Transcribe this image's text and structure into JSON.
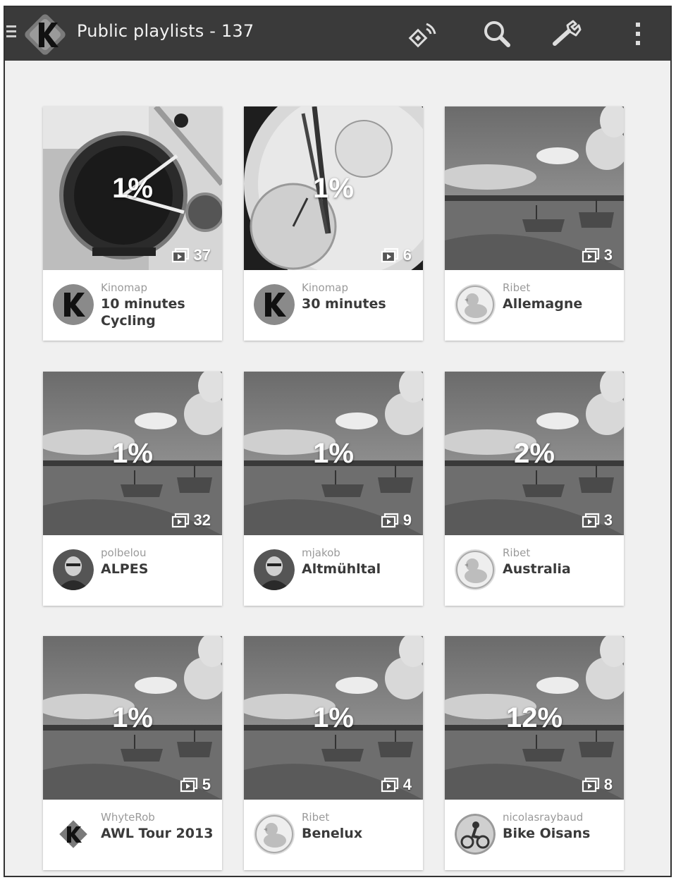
{
  "app": {
    "title": "Public playlists - 137",
    "colors": {
      "appbar": "#3a3a3a",
      "background": "#f0f0f0",
      "card": "#ffffff"
    }
  },
  "toolbar": {
    "icons": [
      "menu-icon",
      "kinomap-logo",
      "cast-icon",
      "search-icon",
      "wrench-icon",
      "overflow-menu-icon"
    ]
  },
  "playlists": [
    {
      "progress": "1%",
      "count": "37",
      "author": "Kinomap",
      "name": "10 minutes Cycling",
      "thumb": "speedometer",
      "avatar": "kinomap-avatar"
    },
    {
      "progress": "1%",
      "count": "6",
      "author": "Kinomap",
      "name": "30 minutes",
      "thumb": "watch",
      "avatar": "kinomap-avatar"
    },
    {
      "progress": "",
      "count": "3",
      "author": "Ribet",
      "name": "Allemagne",
      "thumb": "lake",
      "avatar": "duck-avatar"
    },
    {
      "progress": "1%",
      "count": "32",
      "author": "polbelou",
      "name": "ALPES",
      "thumb": "lake",
      "avatar": "person-avatar"
    },
    {
      "progress": "1%",
      "count": "9",
      "author": "mjakob",
      "name": "Altmühltal",
      "thumb": "lake",
      "avatar": "person-avatar"
    },
    {
      "progress": "2%",
      "count": "3",
      "author": "Ribet",
      "name": "Australia",
      "thumb": "lake",
      "avatar": "duck-avatar"
    },
    {
      "progress": "1%",
      "count": "5",
      "author": "WhyteRob",
      "name": "AWL Tour 2013",
      "thumb": "lake",
      "avatar": "kinomap-small-avatar"
    },
    {
      "progress": "1%",
      "count": "4",
      "author": "Ribet",
      "name": "Benelux",
      "thumb": "lake",
      "avatar": "duck-avatar"
    },
    {
      "progress": "12%",
      "count": "8",
      "author": "nicolasraybaud",
      "name": "Bike Oisans",
      "thumb": "lake",
      "avatar": "cyclist-avatar"
    }
  ]
}
